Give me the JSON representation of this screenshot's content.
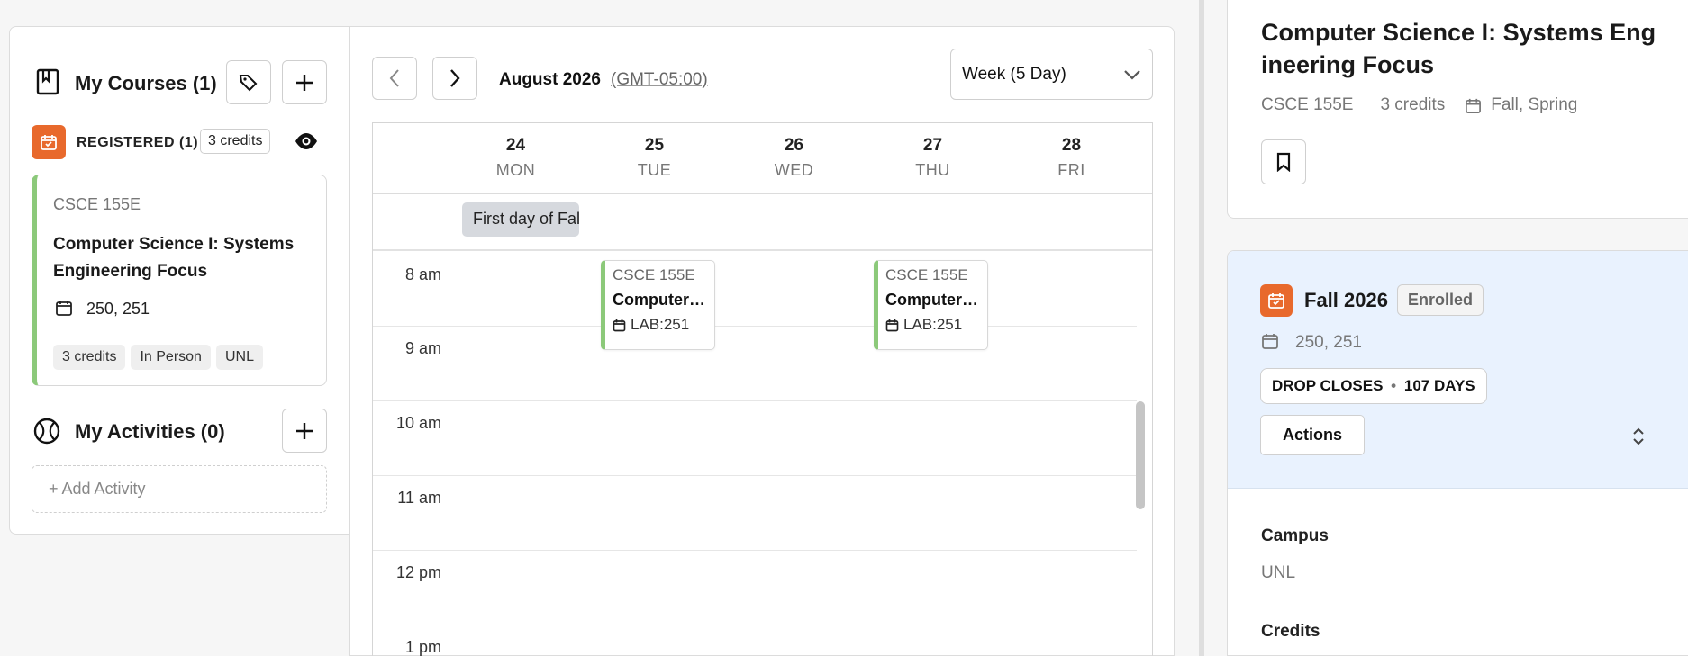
{
  "courses_panel": {
    "title": "My Courses (1)",
    "registered_label": "REGISTERED (1)",
    "registered_credits": "3 credits",
    "course_card": {
      "code": "CSCE 155E",
      "title": "Computer Science I: Systems Engineering Focus",
      "sections": "250, 251",
      "tags": [
        "3 credits",
        "In Person",
        "UNL"
      ]
    },
    "activities_title": "My Activities (0)",
    "add_activity_label": "+ Add Activity"
  },
  "calendar": {
    "month_label": "August 2026",
    "timezone_label": "(GMT-05:00)",
    "view_selected": "Week (5 Day)",
    "days": [
      {
        "num": "24",
        "name": "MON"
      },
      {
        "num": "25",
        "name": "TUE"
      },
      {
        "num": "26",
        "name": "WED"
      },
      {
        "num": "27",
        "name": "THU"
      },
      {
        "num": "28",
        "name": "FRI"
      }
    ],
    "all_day_event": "First day of Fall",
    "hours": [
      "8 am",
      "9 am",
      "10 am",
      "11 am",
      "12 pm",
      "1 pm"
    ],
    "events": [
      {
        "code": "CSCE 155E",
        "title": "Computer Science I: Systems Engineering Focus",
        "location": "LAB:251",
        "day": "TUE"
      },
      {
        "code": "CSCE 155E",
        "title": "Computer Science I: Systems Engineering Focus",
        "location": "LAB:251",
        "day": "THU"
      }
    ]
  },
  "detail": {
    "title": "Computer Science I: Systems Engineering Focus",
    "code": "CSCE 155E",
    "credits": "3 credits",
    "terms": "Fall, Spring",
    "term_section": {
      "term": "Fall 2026",
      "status": "Enrolled",
      "sections": "250, 251",
      "drop_closes": "DROP CLOSES",
      "drop_days": "107 DAYS",
      "actions_label": "Actions"
    },
    "campus_label": "Campus",
    "campus_value": "UNL",
    "credits_label": "Credits"
  },
  "colors": {
    "accent_orange": "#e8692c",
    "course_green": "#8cc97a",
    "term_bg": "#e9f2fe"
  }
}
